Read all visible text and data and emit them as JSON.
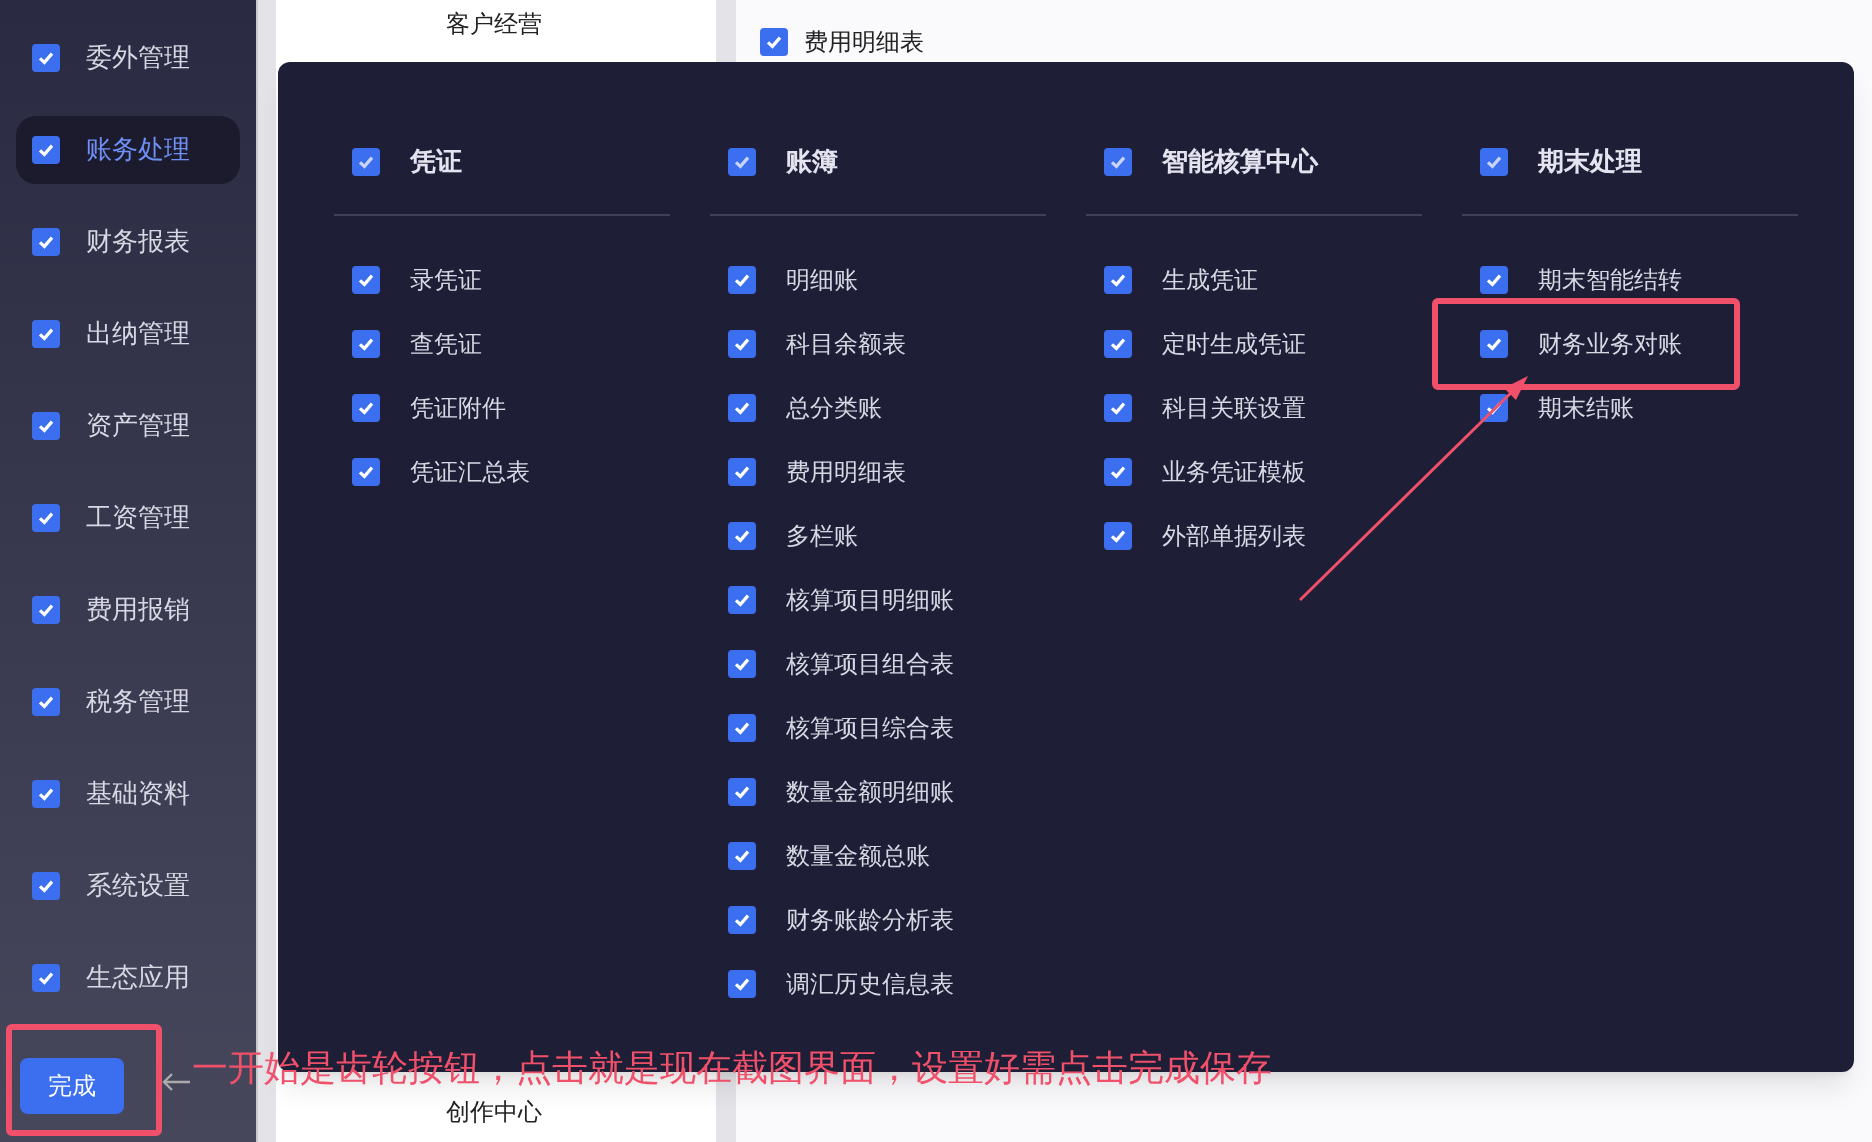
{
  "sidebar": {
    "items": [
      {
        "label": "委外管理",
        "checked": true,
        "selected": false
      },
      {
        "label": "账务处理",
        "checked": true,
        "selected": true
      },
      {
        "label": "财务报表",
        "checked": true,
        "selected": false
      },
      {
        "label": "出纳管理",
        "checked": true,
        "selected": false
      },
      {
        "label": "资产管理",
        "checked": true,
        "selected": false
      },
      {
        "label": "工资管理",
        "checked": true,
        "selected": false
      },
      {
        "label": "费用报销",
        "checked": true,
        "selected": false
      },
      {
        "label": "税务管理",
        "checked": true,
        "selected": false
      },
      {
        "label": "基础资料",
        "checked": true,
        "selected": false
      },
      {
        "label": "系统设置",
        "checked": true,
        "selected": false
      },
      {
        "label": "生态应用",
        "checked": true,
        "selected": false
      }
    ],
    "done_button": {
      "label": "完成",
      "highlighted": true
    }
  },
  "background": {
    "top_label": "客户经营",
    "bottom_label": "创作中心",
    "rows": [
      {
        "label": "费用明细表",
        "checked": true
      }
    ]
  },
  "panel": {
    "columns": [
      {
        "title": "凭证",
        "checked": true,
        "items": [
          {
            "label": "录凭证",
            "checked": true,
            "highlighted": false
          },
          {
            "label": "查凭证",
            "checked": true,
            "highlighted": false
          },
          {
            "label": "凭证附件",
            "checked": true,
            "highlighted": false
          },
          {
            "label": "凭证汇总表",
            "checked": true,
            "highlighted": false
          }
        ]
      },
      {
        "title": "账簿",
        "checked": true,
        "items": [
          {
            "label": "明细账",
            "checked": true,
            "highlighted": false
          },
          {
            "label": "科目余额表",
            "checked": true,
            "highlighted": false
          },
          {
            "label": "总分类账",
            "checked": true,
            "highlighted": false
          },
          {
            "label": "费用明细表",
            "checked": true,
            "highlighted": false
          },
          {
            "label": "多栏账",
            "checked": true,
            "highlighted": false
          },
          {
            "label": "核算项目明细账",
            "checked": true,
            "highlighted": false
          },
          {
            "label": "核算项目组合表",
            "checked": true,
            "highlighted": false
          },
          {
            "label": "核算项目综合表",
            "checked": true,
            "highlighted": false
          },
          {
            "label": "数量金额明细账",
            "checked": true,
            "highlighted": false
          },
          {
            "label": "数量金额总账",
            "checked": true,
            "highlighted": false
          },
          {
            "label": "财务账龄分析表",
            "checked": true,
            "highlighted": false
          },
          {
            "label": "调汇历史信息表",
            "checked": true,
            "highlighted": false
          }
        ]
      },
      {
        "title": "智能核算中心",
        "checked": true,
        "items": [
          {
            "label": "生成凭证",
            "checked": true,
            "highlighted": false
          },
          {
            "label": "定时生成凭证",
            "checked": true,
            "highlighted": false
          },
          {
            "label": "科目关联设置",
            "checked": true,
            "highlighted": false
          },
          {
            "label": "业务凭证模板",
            "checked": true,
            "highlighted": false
          },
          {
            "label": "外部单据列表",
            "checked": true,
            "highlighted": false
          }
        ]
      },
      {
        "title": "期末处理",
        "checked": true,
        "items": [
          {
            "label": "期末智能结转",
            "checked": true,
            "highlighted": false
          },
          {
            "label": "财务业务对账",
            "checked": true,
            "highlighted": true
          },
          {
            "label": "期末结账",
            "checked": true,
            "highlighted": false
          }
        ]
      }
    ]
  },
  "annotation": {
    "note": "一开始是齿轮按钮，点击就是现在截图界面，设置好需点击完成保存"
  }
}
